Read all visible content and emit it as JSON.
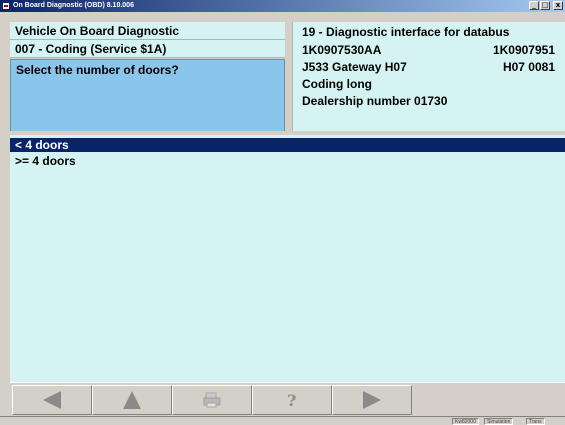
{
  "window": {
    "title": "On Board Diagnostic (OBD) 8.10.006",
    "controls": [
      "_",
      "□",
      "x"
    ]
  },
  "header": {
    "app_name": "Vehicle On Board Diagnostic",
    "function": "007 - Coding (Service $1A)"
  },
  "prompt": "Select the number of doors?",
  "controller": {
    "address": "19 - Diagnostic interface for databus",
    "part_number": "1K0907530AA",
    "part_number_right": "1K0907951",
    "component": "J533 Gateway  H07",
    "component_right": "H07 0081",
    "coding": "Coding long",
    "dealership": "Dealership number 01730"
  },
  "options": [
    {
      "label": "< 4 doors",
      "selected": true
    },
    {
      "label": ">= 4 doors",
      "selected": false
    }
  ],
  "toolbar": {
    "buttons": [
      {
        "icon": "arrow-left-icon",
        "enabled": true
      },
      {
        "icon": "arrow-up-icon",
        "enabled": true
      },
      {
        "icon": "printer-icon",
        "enabled": false
      },
      {
        "icon": "help-icon",
        "enabled": true
      },
      {
        "icon": "arrow-right-icon",
        "enabled": true
      }
    ]
  },
  "status": {
    "cell1": "Kw82000",
    "cell2": "Simulation",
    "cell3": "Trans"
  },
  "colors": {
    "header_bg": "#d6f3f4",
    "prompt_bg": "#8ac6ec",
    "selected_bg": "#0a246a"
  }
}
